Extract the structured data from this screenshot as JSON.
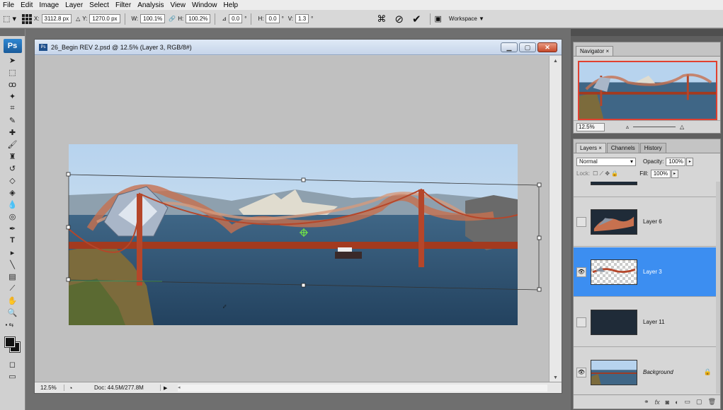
{
  "menu": [
    "File",
    "Edit",
    "Image",
    "Layer",
    "Select",
    "Filter",
    "Analysis",
    "View",
    "Window",
    "Help"
  ],
  "options": {
    "x_label": "X:",
    "x_value": "3112.8 px",
    "y_label": "Y:",
    "y_value": "1270.0 px",
    "w_label": "W:",
    "w_value": "100.1%",
    "h_label": "H:",
    "h_value": "100.2%",
    "angle_value": "0.0",
    "hskew_label": "H:",
    "hskew_value": "0.0",
    "vskew_label": "V:",
    "vskew_value": "1.3",
    "degree": "°",
    "workspace": "Workspace"
  },
  "toolbox": {
    "logo": "Ps"
  },
  "document": {
    "title": "26_Begin REV 2.psd @ 12.5% (Layer 3, RGB/8#)",
    "zoom": "12.5%",
    "doc_size": "Doc: 44.5M/277.8M"
  },
  "navigator": {
    "tab": "Navigator",
    "zoom": "12.5%"
  },
  "layers": {
    "tabs": [
      "Layers",
      "Channels",
      "History"
    ],
    "blend_mode": "Normal",
    "opacity_label": "Opacity:",
    "opacity": "100%",
    "lock_label": "Lock:",
    "fill_label": "Fill:",
    "fill": "100%",
    "items": [
      {
        "name": "Layer 6",
        "visible": false,
        "selected": false
      },
      {
        "name": "Layer 3",
        "visible": true,
        "selected": true
      },
      {
        "name": "Layer 11",
        "visible": false,
        "selected": false
      },
      {
        "name": "Background",
        "visible": true,
        "selected": false,
        "locked": true
      }
    ]
  },
  "colors": {
    "accent": "#3c8ef1",
    "close": "#c74a2b",
    "sky": "#9ec3e6",
    "water": "#2e5578",
    "bridge": "#b5462a"
  }
}
